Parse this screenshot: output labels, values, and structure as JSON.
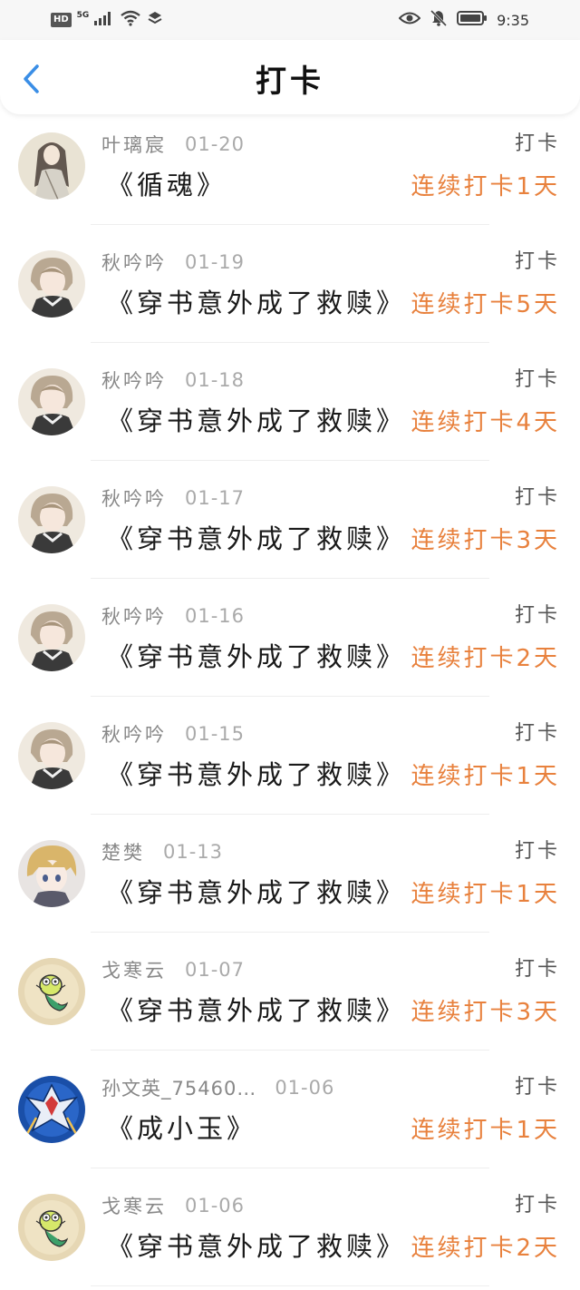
{
  "status_bar": {
    "hd": "HD",
    "network": "5G",
    "time": "9:35"
  },
  "header": {
    "title": "打卡"
  },
  "colors": {
    "accent_orange": "#e8813d",
    "back_blue": "#3a8ee6"
  },
  "entries": [
    {
      "user": "叶璃宸",
      "date": "01-20",
      "book": "《循魂》",
      "action": "打卡",
      "streak": "连续打卡1天",
      "avatar": "avatar-girl-ink"
    },
    {
      "user": "秋吟吟",
      "date": "01-19",
      "book": "《穿书意外成了救赎》",
      "action": "打卡",
      "streak": "连续打卡5天",
      "avatar": "avatar-anime-boy"
    },
    {
      "user": "秋吟吟",
      "date": "01-18",
      "book": "《穿书意外成了救赎》",
      "action": "打卡",
      "streak": "连续打卡4天",
      "avatar": "avatar-anime-boy"
    },
    {
      "user": "秋吟吟",
      "date": "01-17",
      "book": "《穿书意外成了救赎》",
      "action": "打卡",
      "streak": "连续打卡3天",
      "avatar": "avatar-anime-boy"
    },
    {
      "user": "秋吟吟",
      "date": "01-16",
      "book": "《穿书意外成了救赎》",
      "action": "打卡",
      "streak": "连续打卡2天",
      "avatar": "avatar-anime-boy"
    },
    {
      "user": "秋吟吟",
      "date": "01-15",
      "book": "《穿书意外成了救赎》",
      "action": "打卡",
      "streak": "连续打卡1天",
      "avatar": "avatar-anime-boy"
    },
    {
      "user": "楚樊",
      "date": "01-13",
      "book": "《穿书意外成了救赎》",
      "action": "打卡",
      "streak": "连续打卡1天",
      "avatar": "avatar-blond-boy"
    },
    {
      "user": "戈寒云",
      "date": "01-07",
      "book": "《穿书意外成了救赎》",
      "action": "打卡",
      "streak": "连续打卡3天",
      "avatar": "avatar-cartoon-mermaid"
    },
    {
      "user": "孙文英_75460…",
      "date": "01-06",
      "book": "《成小玉》",
      "action": "打卡",
      "streak": "连续打卡1天",
      "avatar": "avatar-robot"
    },
    {
      "user": "戈寒云",
      "date": "01-06",
      "book": "《穿书意外成了救赎》",
      "action": "打卡",
      "streak": "连续打卡2天",
      "avatar": "avatar-cartoon-mermaid"
    }
  ]
}
